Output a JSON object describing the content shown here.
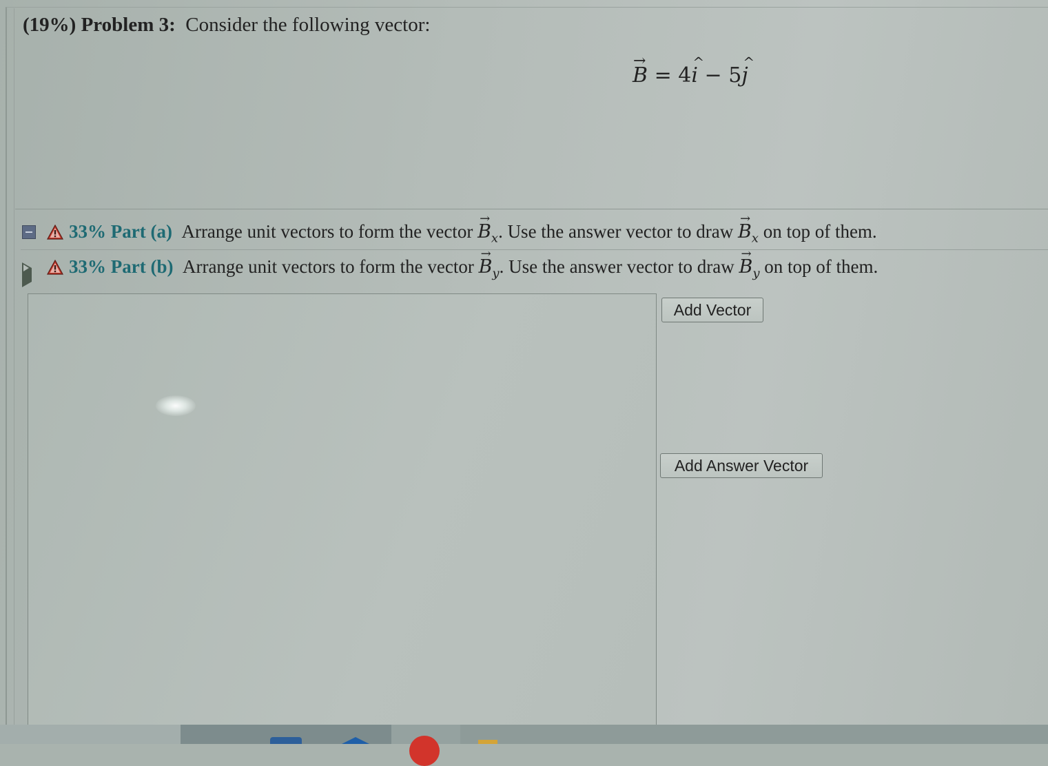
{
  "problem": {
    "percent": "(19%)",
    "number": "Problem 3:",
    "prompt": "Consider the following vector:"
  },
  "equation": {
    "vector": "B",
    "equals": "=",
    "x_coef": "4",
    "x_unit": "i",
    "minus": "−",
    "y_coef": "5",
    "y_unit": "j"
  },
  "parts": [
    {
      "percent_label": "33% Part (a)",
      "text_before": "Arrange unit vectors to form the vector",
      "vec": "B",
      "sub": "x",
      "text_middle": ". Use the answer vector to draw",
      "text_after": "on top of them."
    },
    {
      "percent_label": "33% Part (b)",
      "text_before": "Arrange unit vectors to form the vector",
      "vec": "B",
      "sub": "y",
      "text_middle": ". Use the answer vector to draw",
      "text_after": "on top of them."
    }
  ],
  "buttons": {
    "add_vector": "Add Vector",
    "add_answer_vector": "Add Answer Vector"
  },
  "colors": {
    "part_label": "#1e6a73",
    "warning": "#c0392b"
  }
}
